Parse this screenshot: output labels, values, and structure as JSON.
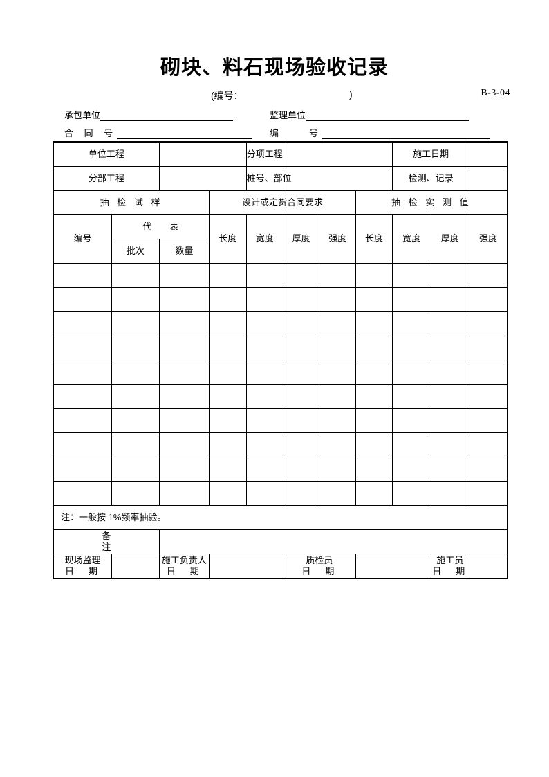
{
  "document": {
    "title": "砌块、料石现场验收记录",
    "subtitle_open": "(编号：",
    "subtitle_close": ")",
    "form_code": "B-3-04"
  },
  "header_fields": [
    {
      "label": "承包单位",
      "value": ""
    },
    {
      "label": "监理单位",
      "value": ""
    },
    {
      "label": "合 同 号",
      "value": ""
    },
    {
      "label": "编　　号",
      "value": ""
    }
  ],
  "info_rows": [
    {
      "label1": "单位工程",
      "value1": "",
      "label2": "分项工程",
      "value2": "",
      "label3": "施工日期",
      "value3": ""
    },
    {
      "label1": "分部工程",
      "value1": "",
      "label2": "桩号、部位",
      "value2": "",
      "label3": "检测、记录",
      "value3": ""
    }
  ],
  "table": {
    "group_headers": [
      "抽 检 试 样",
      "设计或定货合同要求",
      "抽 检 实 测 值"
    ],
    "sub_headers": {
      "id": "编号",
      "represent": "代　　表",
      "batch": "批次",
      "quantity": "数量",
      "design": [
        "长度",
        "宽度",
        "厚度",
        "强度"
      ],
      "measured": [
        "长度",
        "宽度",
        "厚度",
        "强度"
      ]
    },
    "data_rows": [
      [
        "",
        "",
        "",
        "",
        "",
        "",
        "",
        "",
        "",
        "",
        ""
      ],
      [
        "",
        "",
        "",
        "",
        "",
        "",
        "",
        "",
        "",
        "",
        ""
      ],
      [
        "",
        "",
        "",
        "",
        "",
        "",
        "",
        "",
        "",
        "",
        ""
      ],
      [
        "",
        "",
        "",
        "",
        "",
        "",
        "",
        "",
        "",
        "",
        ""
      ],
      [
        "",
        "",
        "",
        "",
        "",
        "",
        "",
        "",
        "",
        "",
        ""
      ],
      [
        "",
        "",
        "",
        "",
        "",
        "",
        "",
        "",
        "",
        "",
        ""
      ],
      [
        "",
        "",
        "",
        "",
        "",
        "",
        "",
        "",
        "",
        "",
        ""
      ],
      [
        "",
        "",
        "",
        "",
        "",
        "",
        "",
        "",
        "",
        "",
        ""
      ],
      [
        "",
        "",
        "",
        "",
        "",
        "",
        "",
        "",
        "",
        "",
        ""
      ],
      [
        "",
        "",
        "",
        "",
        "",
        "",
        "",
        "",
        "",
        "",
        ""
      ]
    ]
  },
  "note": "注：一般按 1%频率抽验。",
  "remark": {
    "label_line1": "备",
    "label_line2": "注",
    "value": ""
  },
  "signatures": [
    {
      "role": "现场监理",
      "date_label": "日　期",
      "value": ""
    },
    {
      "role": "施工负责人",
      "date_label": "日　期",
      "value": ""
    },
    {
      "role": "质检员",
      "date_label": "日　期",
      "value": ""
    },
    {
      "role": "施工员",
      "date_label": "日　期",
      "value": ""
    }
  ]
}
